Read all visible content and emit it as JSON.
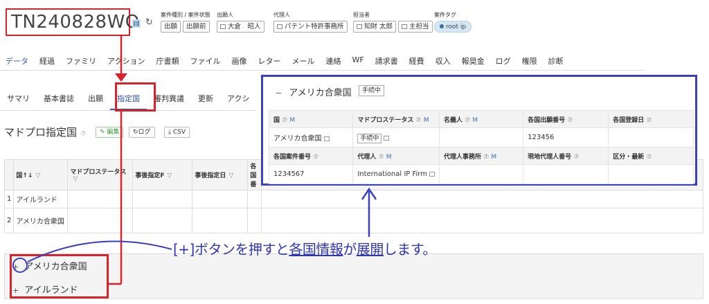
{
  "header": {
    "case_no": "TN240828WO",
    "groups": [
      {
        "label": "案件種別 / 案件状態",
        "chips": [
          "出願",
          "出願前"
        ],
        "icon": false
      },
      {
        "label": "出願人",
        "chips": [
          "大倉　昭人"
        ],
        "icon": true
      },
      {
        "label": "代理人",
        "chips": [
          "パテント特許事務所"
        ],
        "icon": true
      },
      {
        "label": "担当者",
        "chips": [
          "知財 太郎",
          "主担当"
        ],
        "icon": true
      },
      {
        "label": "案件タグ",
        "tag": "root ip"
      }
    ]
  },
  "main_tabs": [
    "データ",
    "経過",
    "ファミリ",
    "アクション",
    "庁書類",
    "ファイル",
    "画像",
    "レター",
    "メール",
    "連絡",
    "WF",
    "請求書",
    "経費",
    "収入",
    "報奨金",
    "ログ",
    "権限",
    "診断"
  ],
  "sub_tabs": [
    "サマリ",
    "基本書誌",
    "出願",
    "指定国",
    "審判異議",
    "更新",
    "アクシ"
  ],
  "section": {
    "title": "マドプロ指定国",
    "help": "⑦",
    "edit_label": "編集",
    "log_label": "ログ",
    "csv_label": "CSV"
  },
  "table": {
    "headers": [
      "国↑↓",
      "マドプロステータス",
      "事後指定F",
      "事後指定日",
      "各国番"
    ],
    "rows": [
      {
        "no": "1",
        "country": "アイルランド"
      },
      {
        "no": "2",
        "country": "アメリカ合衆国"
      }
    ]
  },
  "collapsed": [
    {
      "sign": "+",
      "name": "アメリカ合衆国"
    },
    {
      "sign": "+",
      "name": "アイルランド"
    }
  ],
  "callout": {
    "part1": "[+]ボタンを押すと",
    "part2": "各国情報",
    "part3": "が",
    "part4": "展開",
    "part5": "します。"
  },
  "detail": {
    "sign": "−",
    "country": "アメリカ合衆国",
    "status": "手続中",
    "row1_headers": [
      "国",
      "マドプロステータス",
      "名義人",
      "各国出願番号",
      "各国登録日"
    ],
    "row1_values": [
      "アメリカ合衆国",
      "手続中",
      "",
      "123456",
      ""
    ],
    "row2_headers": [
      "各国案件番号",
      "代理人",
      "代理人事務所",
      "現地代理人番号",
      "区分・最新"
    ],
    "row2_values": [
      "1234567",
      "International IP Firm",
      "",
      "",
      ""
    ],
    "q": "⑦",
    "m": "M"
  },
  "colors": {
    "red": "#d9232a",
    "blue": "#3a3fc4",
    "active_tab": "#2f55c8"
  }
}
